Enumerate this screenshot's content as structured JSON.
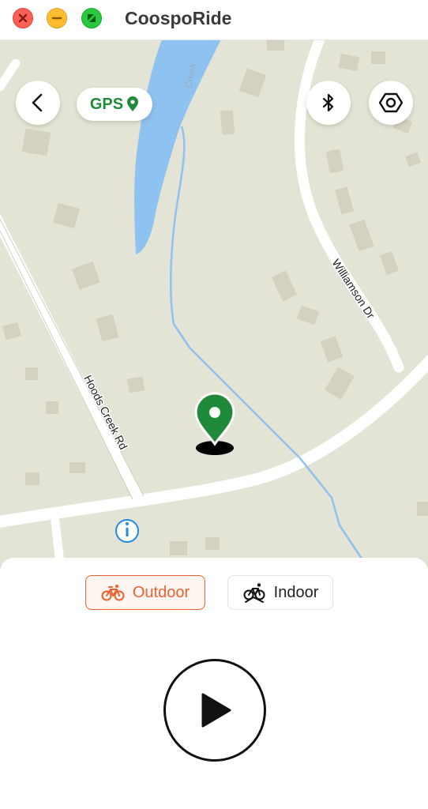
{
  "window": {
    "title": "CoospoRide",
    "controls": [
      "close-icon",
      "minimize-icon",
      "zoom-icon"
    ]
  },
  "map": {
    "street_labels": [
      "Hoods Creek Rd",
      "Williamson Dr",
      "Creek"
    ],
    "location_marker": "map-pin-icon",
    "info_icon": "info-icon"
  },
  "toolbar": {
    "back_icon": "chevron-left-icon",
    "gps_label": "GPS",
    "gps_icon": "location-pin-icon",
    "bluetooth_icon": "bluetooth-icon",
    "settings_icon": "hexagon-nut-icon"
  },
  "modes": {
    "outdoor_label": "Outdoor",
    "indoor_label": "Indoor",
    "selected": "Outdoor"
  },
  "actions": {
    "start_icon": "play-icon"
  },
  "colors": {
    "accent": "#f0602f",
    "gps_green": "#1f8b3a",
    "map_bg": "#e3e4d5",
    "water": "#8ec2f0"
  }
}
